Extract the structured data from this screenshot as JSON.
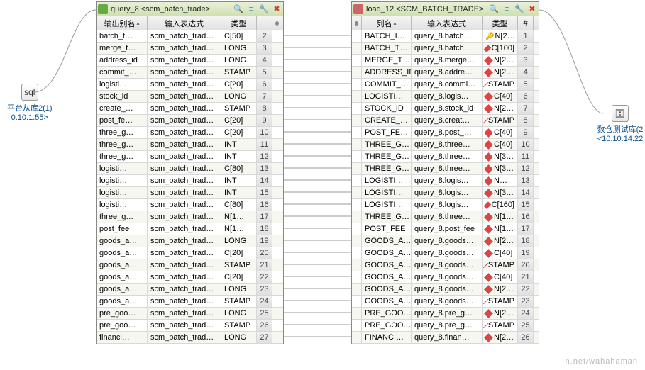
{
  "leftNode": {
    "label": "平台从库2(1)",
    "addr": "0.10.1.55>",
    "icon": "sql"
  },
  "rightNode": {
    "label": "数仓测试库(2",
    "addr": "<10.10.14.22",
    "icon": "db"
  },
  "panel1": {
    "title": "query_8 <scm_batch_trade>",
    "headers": {
      "c1": "输出别名",
      "c2": "输入表达式",
      "c3": "类型",
      "c4": ""
    },
    "rows": [
      {
        "a": "batch_t…",
        "b": "scm_batch_trad…",
        "c": "C[50]",
        "n": "2"
      },
      {
        "a": "merge_t…",
        "b": "scm_batch_trad…",
        "c": "LONG",
        "n": "3"
      },
      {
        "a": "address_id",
        "b": "scm_batch_trad…",
        "c": "LONG",
        "n": "4"
      },
      {
        "a": "commit_…",
        "b": "scm_batch_trad…",
        "c": "STAMP",
        "n": "5"
      },
      {
        "a": "logisti…",
        "b": "scm_batch_trad…",
        "c": "C[20]",
        "n": "6"
      },
      {
        "a": "stock_id",
        "b": "scm_batch_trad…",
        "c": "LONG",
        "n": "7"
      },
      {
        "a": "create_…",
        "b": "scm_batch_trad…",
        "c": "STAMP",
        "n": "8"
      },
      {
        "a": "post_fe…",
        "b": "scm_batch_trad…",
        "c": "C[20]",
        "n": "9"
      },
      {
        "a": "three_g…",
        "b": "scm_batch_trad…",
        "c": "C[20]",
        "n": "10"
      },
      {
        "a": "three_g…",
        "b": "scm_batch_trad…",
        "c": "INT",
        "n": "11"
      },
      {
        "a": "three_g…",
        "b": "scm_batch_trad…",
        "c": "INT",
        "n": "12"
      },
      {
        "a": "logisti…",
        "b": "scm_batch_trad…",
        "c": "C[80]",
        "n": "13"
      },
      {
        "a": "logisti…",
        "b": "scm_batch_trad…",
        "c": "INT",
        "n": "14"
      },
      {
        "a": "logisti…",
        "b": "scm_batch_trad…",
        "c": "INT",
        "n": "15"
      },
      {
        "a": "logisti…",
        "b": "scm_batch_trad…",
        "c": "C[80]",
        "n": "16"
      },
      {
        "a": "three_g…",
        "b": "scm_batch_trad…",
        "c": "N[1…",
        "n": "17"
      },
      {
        "a": "post_fee",
        "b": "scm_batch_trad…",
        "c": "N[1…",
        "n": "18"
      },
      {
        "a": "goods_a…",
        "b": "scm_batch_trad…",
        "c": "LONG",
        "n": "19"
      },
      {
        "a": "goods_a…",
        "b": "scm_batch_trad…",
        "c": "C[20]",
        "n": "20"
      },
      {
        "a": "goods_a…",
        "b": "scm_batch_trad…",
        "c": "STAMP",
        "n": "21"
      },
      {
        "a": "goods_a…",
        "b": "scm_batch_trad…",
        "c": "C[20]",
        "n": "22"
      },
      {
        "a": "goods_a…",
        "b": "scm_batch_trad…",
        "c": "LONG",
        "n": "23"
      },
      {
        "a": "goods_a…",
        "b": "scm_batch_trad…",
        "c": "STAMP",
        "n": "24"
      },
      {
        "a": "pre_goo…",
        "b": "scm_batch_trad…",
        "c": "LONG",
        "n": "25"
      },
      {
        "a": "pre_goo…",
        "b": "scm_batch_trad…",
        "c": "STAMP",
        "n": "26"
      },
      {
        "a": "financi…",
        "b": "scm_batch_trad…",
        "c": "LONG",
        "n": "27"
      }
    ]
  },
  "panel2": {
    "title": "load_12 <SCM_BATCH_TRADE>",
    "headers": {
      "c1": "列名",
      "c2": "输入表达式",
      "c3": "类型",
      "c4": "#"
    },
    "rows": [
      {
        "a": "BATCH_I…",
        "b": "query_8.batch…",
        "c": "N[2…",
        "n": "1",
        "key": true
      },
      {
        "a": "BATCH_T…",
        "b": "query_8.batch…",
        "c": "C[100]",
        "n": "2"
      },
      {
        "a": "MERGE_T…",
        "b": "query_8.merge…",
        "c": "N[2…",
        "n": "3"
      },
      {
        "a": "ADDRESS_ID",
        "b": "query_8.addre…",
        "c": "N[2…",
        "n": "4"
      },
      {
        "a": "COMMIT_…",
        "b": "query_8.commi…",
        "c": "STAMP",
        "n": "5"
      },
      {
        "a": "LOGISTI…",
        "b": "query_8.logis…",
        "c": "C[40]",
        "n": "6"
      },
      {
        "a": "STOCK_ID",
        "b": "query_8.stock_id",
        "c": "N[2…",
        "n": "7"
      },
      {
        "a": "CREATE_…",
        "b": "query_8.creat…",
        "c": "STAMP",
        "n": "8"
      },
      {
        "a": "POST_FE…",
        "b": "query_8.post_…",
        "c": "C[40]",
        "n": "9"
      },
      {
        "a": "THREE_G…",
        "b": "query_8.three…",
        "c": "C[40]",
        "n": "10"
      },
      {
        "a": "THREE_G…",
        "b": "query_8.three…",
        "c": "N[3…",
        "n": "11"
      },
      {
        "a": "THREE_G…",
        "b": "query_8.three…",
        "c": "N[3…",
        "n": "12"
      },
      {
        "a": "LOGISTI…",
        "b": "query_8.logis…",
        "c": "N…",
        "n": "13"
      },
      {
        "a": "LOGISTI…",
        "b": "query_8.logis…",
        "c": "N[3…",
        "n": "14"
      },
      {
        "a": "LOGISTI…",
        "b": "query_8.logis…",
        "c": "C[160]",
        "n": "15"
      },
      {
        "a": "THREE_G…",
        "b": "query_8.three…",
        "c": "N[1…",
        "n": "16"
      },
      {
        "a": "POST_FEE",
        "b": "query_8.post_fee",
        "c": "N[1…",
        "n": "17"
      },
      {
        "a": "GOODS_A…",
        "b": "query_8.goods…",
        "c": "N[2…",
        "n": "18"
      },
      {
        "a": "GOODS_A…",
        "b": "query_8.goods…",
        "c": "C[40]",
        "n": "19"
      },
      {
        "a": "GOODS_A…",
        "b": "query_8.goods…",
        "c": "STAMP",
        "n": "20"
      },
      {
        "a": "GOODS_A…",
        "b": "query_8.goods…",
        "c": "C[40]",
        "n": "21"
      },
      {
        "a": "GOODS_A…",
        "b": "query_8.goods…",
        "c": "N[2…",
        "n": "22"
      },
      {
        "a": "GOODS_A…",
        "b": "query_8.goods…",
        "c": "STAMP",
        "n": "23"
      },
      {
        "a": "PRE_GOO…",
        "b": "query_8.pre_g…",
        "c": "N[2…",
        "n": "24"
      },
      {
        "a": "PRE_GOO…",
        "b": "query_8.pre_g…",
        "c": "STAMP",
        "n": "25"
      },
      {
        "a": "FINANCI…",
        "b": "query_8.finan…",
        "c": "N[2…",
        "n": "26"
      }
    ]
  },
  "watermark": "n.net/wahahaman"
}
